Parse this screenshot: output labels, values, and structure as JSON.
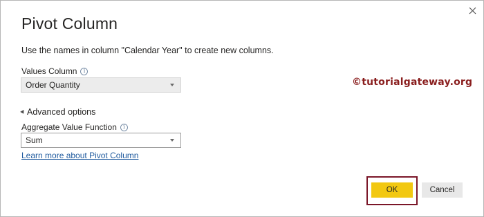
{
  "dialog": {
    "title": "Pivot Column",
    "description": "Use the names in column \"Calendar Year\" to create new columns.",
    "close_icon": "close-icon"
  },
  "values_column": {
    "label": "Values Column",
    "info_icon": "i",
    "selected": "Order Quantity"
  },
  "advanced": {
    "label": "Advanced options"
  },
  "aggregate": {
    "label": "Aggregate Value Function",
    "info_icon": "i",
    "selected": "Sum"
  },
  "learn_more": "Learn more about Pivot Column",
  "watermark": "©tutorialgateway.org",
  "buttons": {
    "ok": "OK",
    "cancel": "Cancel"
  },
  "colors": {
    "ok_bg": "#f2c811",
    "highlight_border": "#7a1628",
    "link": "#1f5a9e",
    "watermark": "#8a1e1e"
  }
}
